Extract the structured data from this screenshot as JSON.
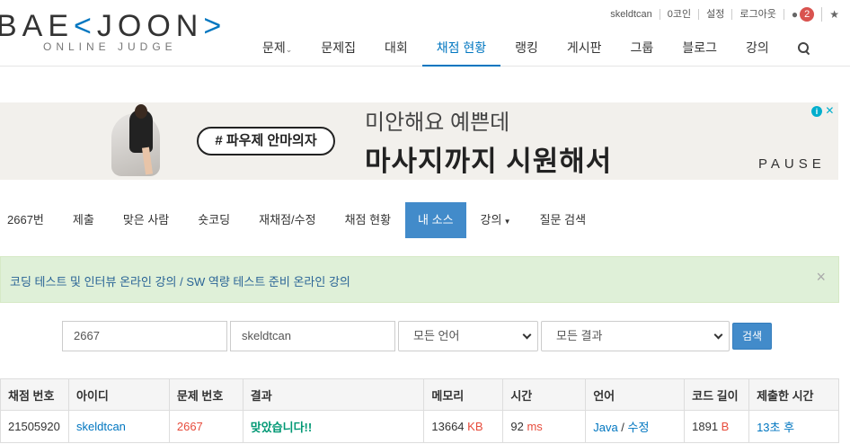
{
  "header": {
    "logo": "BAEKJOON",
    "logo_sub": "ONLINE JUDGE",
    "user": "skeldtcan",
    "coin": "0코인",
    "settings": "설정",
    "logout": "로그아웃",
    "notification_count": "2",
    "star": "★"
  },
  "mainnav": [
    "문제",
    "문제집",
    "대회",
    "채점 현황",
    "랭킹",
    "게시판",
    "그룹",
    "블로그",
    "강의"
  ],
  "ad": {
    "tag": "# 파우제 안마의자",
    "line1": "미안해요 예쁜데",
    "line2": "마사지까지 시원해서",
    "brand": "PAUSE",
    "info_icon": "i",
    "close": "✕"
  },
  "problem_nav": {
    "items": [
      "2667번",
      "제출",
      "맞은 사람",
      "숏코딩",
      "재채점/수정",
      "채점 현황",
      "내 소스",
      "강의"
    ],
    "last": "질문 검색"
  },
  "alert": {
    "link1": "코딩 테스트 및 인터뷰 온라인 강의",
    "sep": " / ",
    "link2": "SW 역량 테스트 준비 온라인 강의",
    "close": "×"
  },
  "filters": {
    "problem_id": "2667",
    "user_id": "skeldtcan",
    "language": "모든 언어",
    "result": "모든 결과",
    "search_label": "검색"
  },
  "table": {
    "headers": [
      "채점 번호",
      "아이디",
      "문제 번호",
      "결과",
      "메모리",
      "시간",
      "언어",
      "코드 길이",
      "제출한 시간"
    ],
    "rows": [
      {
        "id": "21505920",
        "user": "skeldtcan",
        "problem": "2667",
        "result": "맞았습니다!!",
        "memory": "13664",
        "memory_unit": "KB",
        "time": "92",
        "time_unit": "ms",
        "language": "Java",
        "lang_sep": " / ",
        "edit": "수정",
        "code_length": "1891",
        "code_unit": "B",
        "submitted": "13초 후"
      }
    ]
  },
  "colors": {
    "accent": "#0076c0",
    "active_tab": "#428bca",
    "alert_bg": "#dff0d8",
    "accepted": "#009874",
    "red": "#e74c3c"
  }
}
